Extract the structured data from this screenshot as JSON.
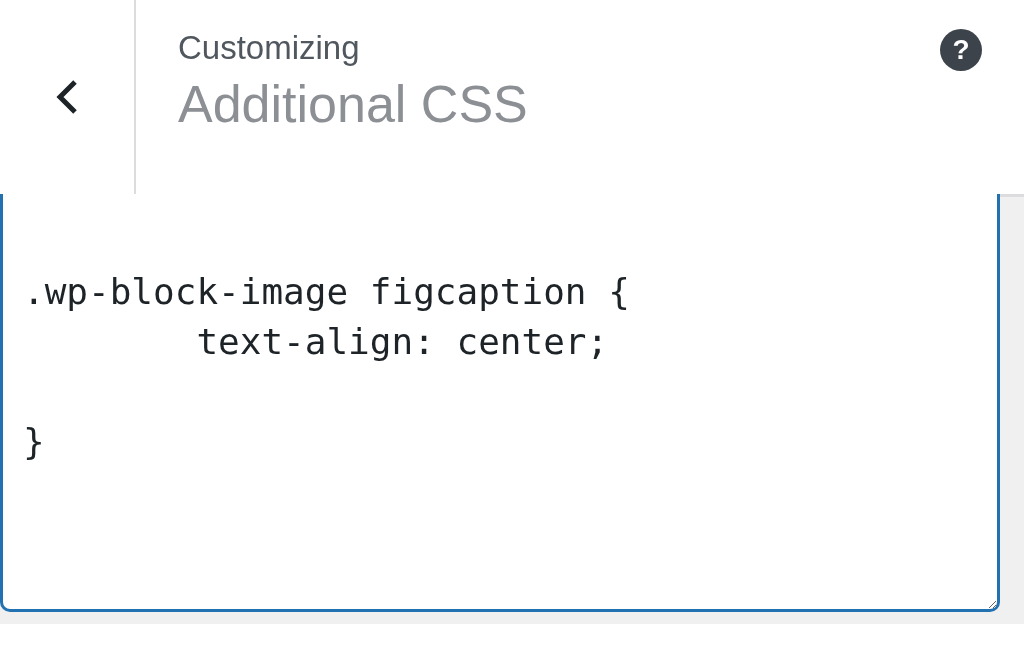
{
  "header": {
    "subtitle": "Customizing",
    "title": "Additional CSS",
    "help_label": "?"
  },
  "editor": {
    "value": "\n.wp-block-image figcaption {\n        text-align: center;\n\n}"
  }
}
